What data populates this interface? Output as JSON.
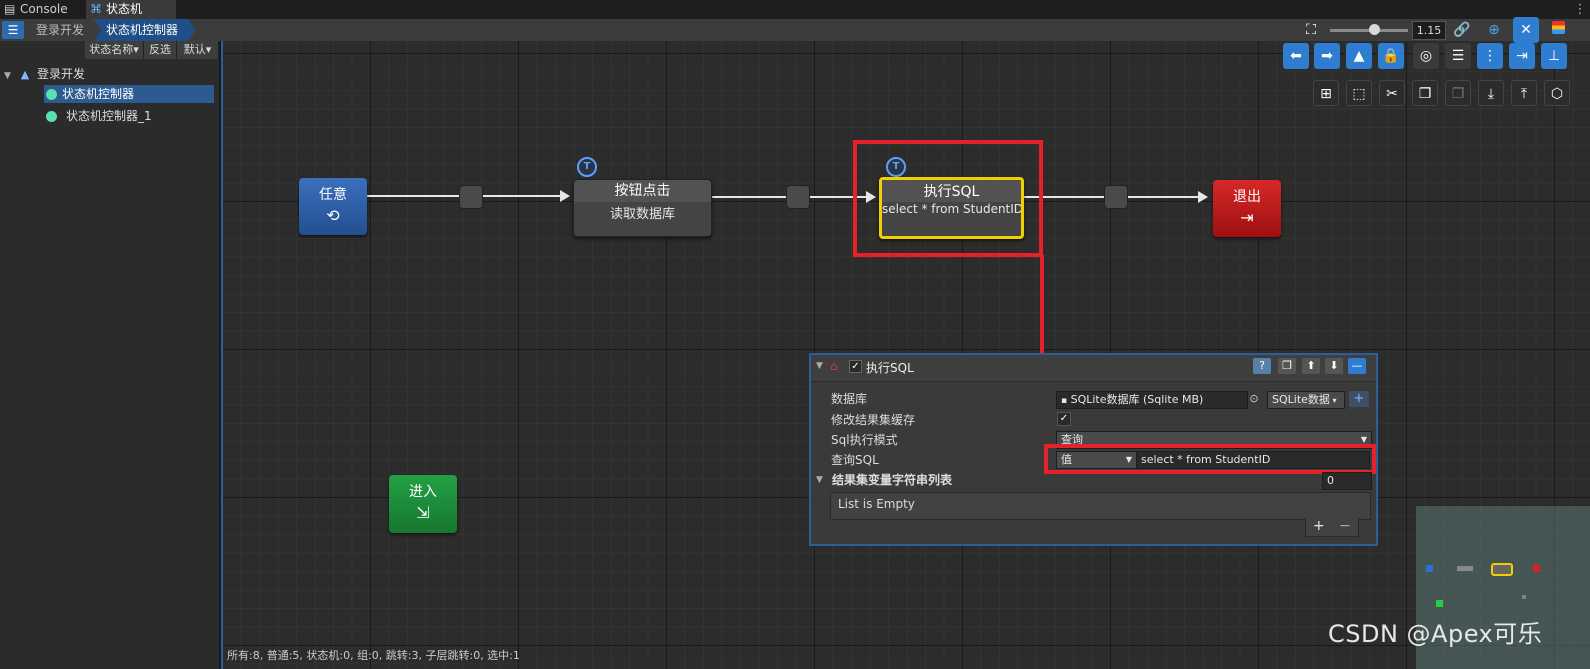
{
  "tabs": [
    {
      "label": "Console",
      "icon": "console-icon"
    },
    {
      "label": "状态机",
      "icon": "state-machine-icon"
    }
  ],
  "breadcrumb": [
    "登录开发",
    "状态机控制器"
  ],
  "left_panel": {
    "buttons": [
      "状态名称▾",
      "反选",
      "默认▾"
    ],
    "tree": {
      "root": "登录开发",
      "items": [
        "状态机控制器",
        "状态机控制器_1"
      ]
    }
  },
  "toolbar": {
    "zoom": "1.15"
  },
  "nodes": {
    "any": {
      "title": "任意"
    },
    "button_click": {
      "title": "按钮点击",
      "subtitle": "读取数据库"
    },
    "exec_sql": {
      "title": "执行SQL",
      "subtitle": "select * from StudentID"
    },
    "exit": {
      "title": "退出"
    },
    "enter": {
      "title": "进入"
    }
  },
  "inspector": {
    "title": "执行SQL",
    "rows": {
      "database_label": "数据库",
      "database_value": "SQLite数据库 (Sqlite MB)",
      "database_type": "SQLite数据",
      "cache_label": "修改结果集缓存",
      "mode_label": "Sql执行模式",
      "mode_value": "查询",
      "query_label": "查询SQL",
      "query_type": "值",
      "query_value": "select * from StudentID",
      "list_label": "结果集变量字符串列表",
      "list_count": "0",
      "list_empty": "List is Empty"
    }
  },
  "status_text": "所有:8, 普通:5, 状态机:0, 组:0, 跳转:3, 子层跳转:0, 选中:1",
  "watermark": "CSDN @Apex可乐",
  "colors": {
    "accent": "#2f7dd1",
    "highlight_red": "#e5222a",
    "selected_yellow": "#f0d000",
    "node_any": "#2d5fa5",
    "node_exit": "#c01b1b",
    "node_enter": "#1e8a3a",
    "tree_dot": "#58e0b3"
  }
}
